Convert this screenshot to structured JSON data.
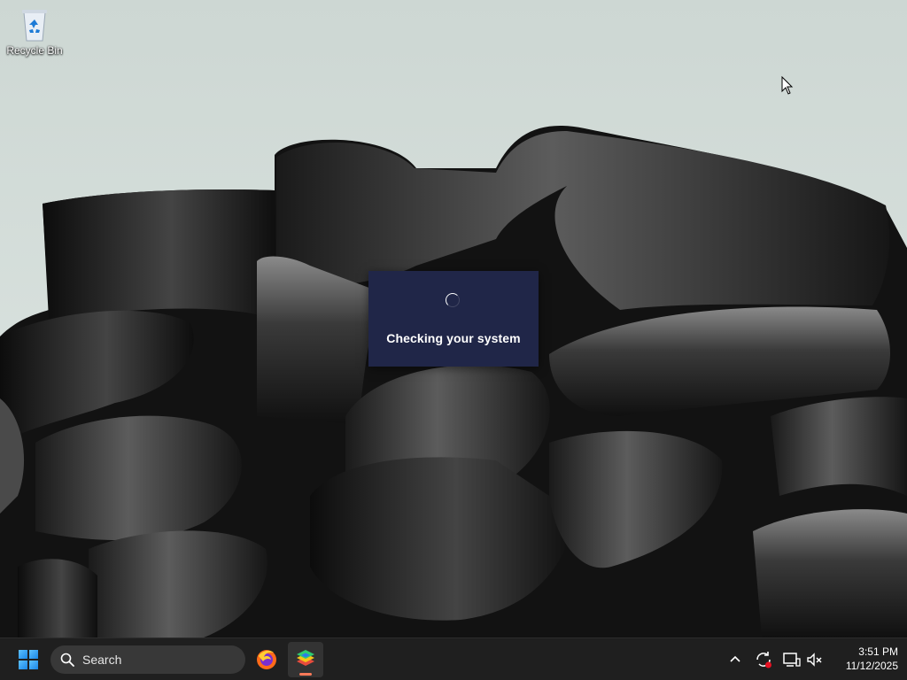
{
  "desktop": {
    "icons": [
      {
        "label": "Recycle Bin",
        "icon": "recycle-bin-icon"
      }
    ]
  },
  "dialog": {
    "message": "Checking your system",
    "spinner_icon": "loading-spinner-icon"
  },
  "taskbar": {
    "start_icon": "windows-start-icon",
    "search": {
      "label": "Search",
      "icon": "search-icon"
    },
    "apps": [
      {
        "name": "firefox",
        "icon": "firefox-icon",
        "active": false
      },
      {
        "name": "bluestacks",
        "icon": "bluestacks-icon",
        "active": true
      }
    ],
    "tray": [
      {
        "icon": "chevron-up-icon"
      },
      {
        "icon": "sync-alert-icon"
      },
      {
        "icon": "network-display-icon"
      },
      {
        "icon": "speaker-muted-icon"
      }
    ],
    "clock": {
      "time": "3:51 PM",
      "date": "11/12/2025"
    }
  },
  "colors": {
    "sky": "#d2dcd8",
    "dialog_bg": "#202648",
    "taskbar_bg": "#1f1f1f",
    "start_blue": "#1a86e6",
    "accent_indicator": "#ff7a59"
  }
}
